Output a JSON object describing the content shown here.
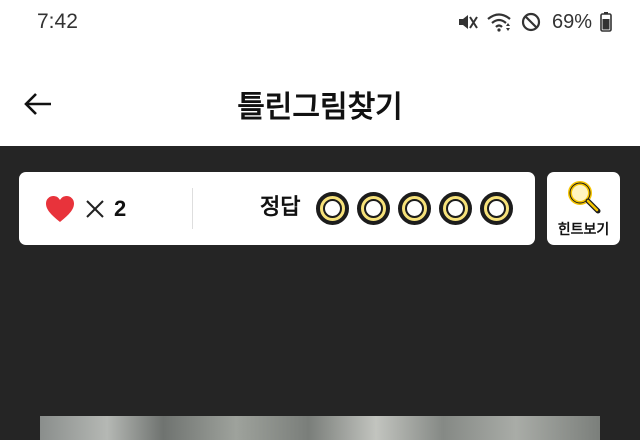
{
  "status_bar": {
    "time": "7:42",
    "battery_percent": "69%",
    "icons": [
      "mute-icon",
      "wifi-icon",
      "do-not-disturb-icon",
      "battery-icon"
    ]
  },
  "header": {
    "title": "틀린그림찾기",
    "back_icon": "back-arrow-icon"
  },
  "score_card": {
    "lives_icon": "heart-icon",
    "lives_count": "2",
    "answer_label": "정답",
    "answers_found": 0,
    "answers_total": 5
  },
  "hint_button": {
    "icon": "magnifier-icon",
    "label": "힌트보기"
  },
  "colors": {
    "game_background": "#252525",
    "heart": "#e8333b",
    "ring_fill": "#f7e27a",
    "hint_icon": "#f5c400"
  }
}
